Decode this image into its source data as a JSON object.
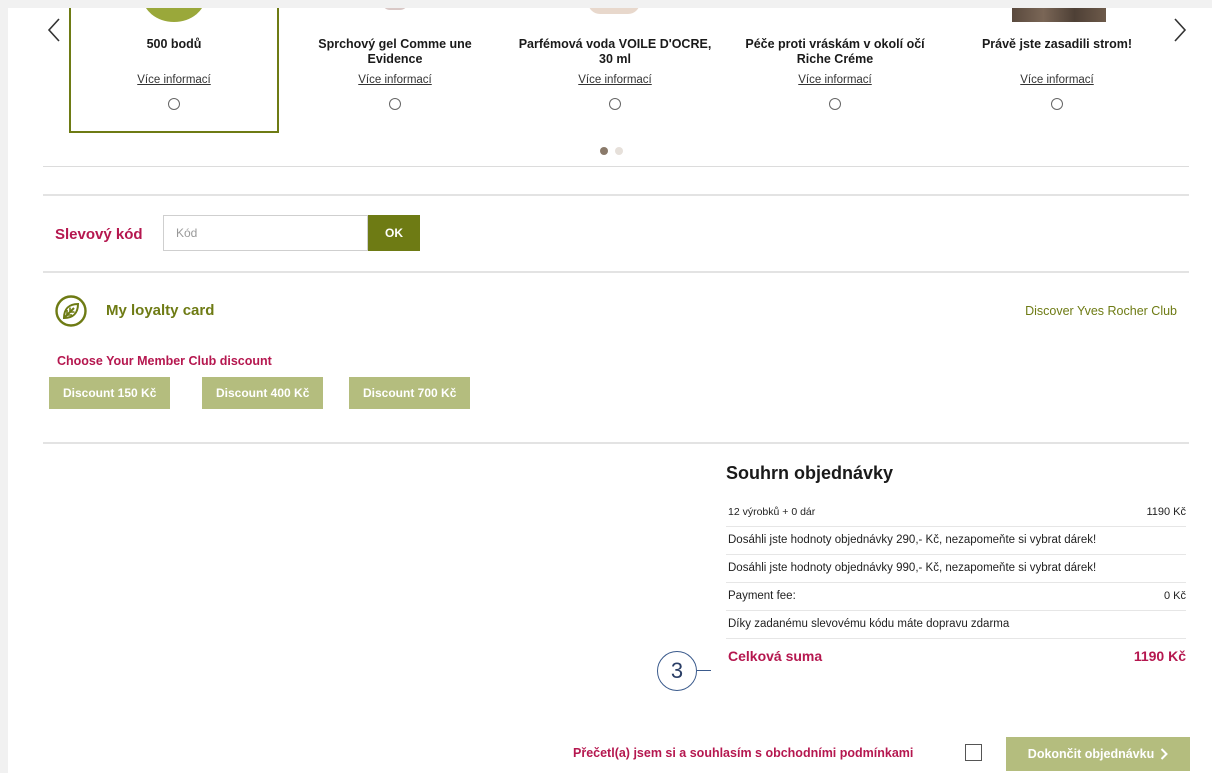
{
  "carousel": {
    "items": [
      {
        "title": "500 bodů",
        "more": "Více informací",
        "selected": true
      },
      {
        "title": "Sprchový gel Comme une Evidence",
        "more": "Více informací",
        "selected": false
      },
      {
        "title": "Parfémová voda VOILE D'OCRE, 30 ml",
        "more": "Více informací",
        "selected": false
      },
      {
        "title": "Péče proti vráskám v okolí očí Riche Créme",
        "more": "Více informací",
        "selected": false
      },
      {
        "title": "Právě jste zasadili strom!",
        "more": "Více informací",
        "selected": false
      }
    ],
    "page_count": 2,
    "active_page": 1
  },
  "promo": {
    "label": "Slevový kód",
    "placeholder": "Kód",
    "ok_label": "OK"
  },
  "loyalty": {
    "title": "My loyalty card",
    "discover_link": "Discover Yves Rocher Club",
    "choose_label": "Choose Your Member Club discount",
    "discounts": [
      "Discount 150 Kč",
      "Discount 400 Kč",
      "Discount 700 Kč"
    ]
  },
  "summary": {
    "title": "Souhrn objednávky",
    "items_label": "12 výrobků + 0 dár",
    "items_value": "1190 Kč",
    "msg1": "Dosáhli jste hodnoty objednávky 290,- Kč, nezapomeňte si vybrat dárek!",
    "msg2": "Dosáhli jste hodnoty objednávky 990,- Kč, nezapomeňte si vybrat dárek!",
    "payment_label": "Payment fee:",
    "payment_value": "0 Kč",
    "free_shipping": "Díky zadanému slevovému kódu máte dopravu zdarma",
    "total_label": "Celková suma",
    "total_value": "1190 Kč"
  },
  "annotation": {
    "number": "3"
  },
  "footer": {
    "terms_label": "Přečetl(a) jsem si a souhlasím s obchodními podmínkami",
    "finish_label": "Dokončit objednávku"
  },
  "colors": {
    "brand_green": "#6e7b14",
    "light_green": "#b4bd7e",
    "accent_pink": "#b5174f"
  }
}
